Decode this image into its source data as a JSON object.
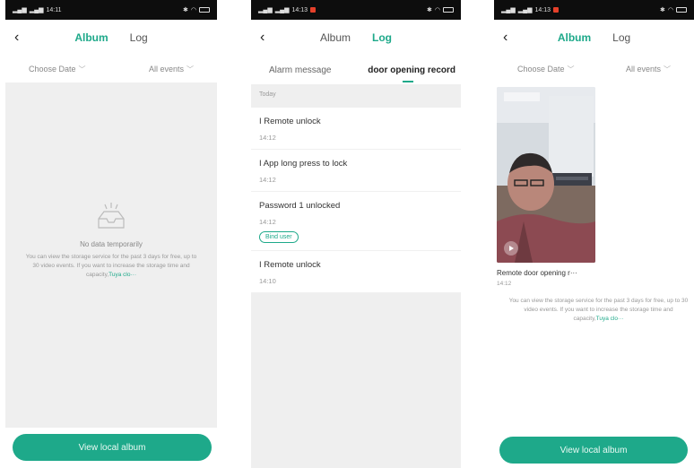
{
  "screens": {
    "album_empty": {
      "status": {
        "time_text": "14:11"
      },
      "tabs": [
        {
          "label": "Album"
        },
        {
          "label": "Log"
        }
      ],
      "filters": {
        "date": "Choose Date",
        "events": "All events"
      },
      "empty_state": {
        "icon": "empty-inbox-icon",
        "title": "No data temporarily",
        "info_text": "You can view the storage service for the past 3 days for free, up to 30 video events. If you want to increase the storage time and capacity,",
        "link_text": "Tuya clo···"
      },
      "button": "View local album"
    },
    "log": {
      "status": {
        "time_text": "14:13"
      },
      "tabs": [
        {
          "label": "Album"
        },
        {
          "label": "Log"
        }
      ],
      "subtabs": [
        {
          "label": "Alarm message"
        },
        {
          "label": "door opening record"
        }
      ],
      "day_label": "Today",
      "items": [
        {
          "title": "I Remote unlock",
          "time": "14:12"
        },
        {
          "title": "I App long press to lock",
          "time": "14:12"
        },
        {
          "title": "Password 1 unlocked",
          "time": "14:12",
          "action": "Bind user"
        },
        {
          "title": "I Remote unlock",
          "time": "14:10"
        }
      ]
    },
    "album_video": {
      "status": {
        "time_text": "14:13"
      },
      "tabs": [
        {
          "label": "Album"
        },
        {
          "label": "Log"
        }
      ],
      "filters": {
        "date": "Choose Date",
        "events": "All events"
      },
      "video": {
        "title": "Remote door opening r···",
        "time": "14:12"
      },
      "info_text": "You can view the storage service for the past 3 days for free, up to 30 video events. If you want to increase the storage time and capacity,",
      "link_text": "Tuya clo···",
      "button": "View local album"
    }
  },
  "colors": {
    "accent": "#1ea98a",
    "empty_bg": "#efefef",
    "status_bar": "#0d0d0d"
  }
}
